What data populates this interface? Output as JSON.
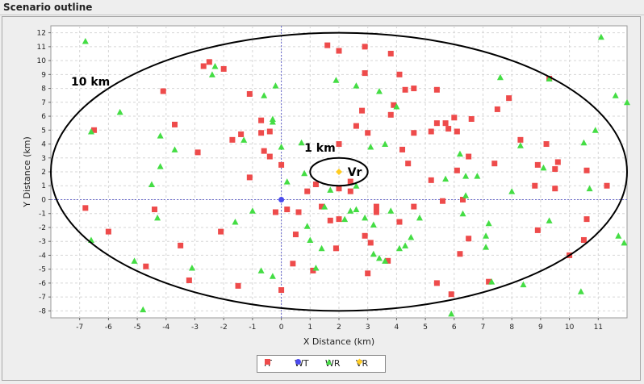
{
  "window": {
    "title": "Scenario outline"
  },
  "chart_data": {
    "type": "scatter",
    "xlabel": "X Distance (km)",
    "ylabel": "Y Distance (km)",
    "xlim": [
      -8,
      12
    ],
    "ylim": [
      -8.5,
      12.5
    ],
    "xticks": [
      -7,
      -6,
      -5,
      -4,
      -3,
      -2,
      -1,
      0,
      1,
      2,
      3,
      4,
      5,
      6,
      7,
      8,
      9,
      10,
      11
    ],
    "yticks": [
      -8,
      -7,
      -6,
      -5,
      -4,
      -3,
      -2,
      -1,
      0,
      1,
      2,
      3,
      4,
      5,
      6,
      7,
      8,
      9,
      10,
      11,
      12
    ],
    "grid": true,
    "legend_position": "bottom-center",
    "circles": [
      {
        "label": "10 km",
        "cx": 2,
        "cy": 2,
        "r": 10
      },
      {
        "label": "1 km",
        "cx": 2,
        "cy": 2,
        "r": 1
      }
    ],
    "annotations": [
      {
        "text": "Vr",
        "x": 2.3,
        "y": 2
      }
    ],
    "colors": {
      "IT": "#ee4b4b",
      "WT": "#4b4bee",
      "WR": "#44dd44",
      "VR": "#ffcc22"
    },
    "series": [
      {
        "name": "IT",
        "marker": "square",
        "points": [
          [
            -6.5,
            5
          ],
          [
            -6.8,
            -0.6
          ],
          [
            -6,
            -2.3
          ],
          [
            -4.4,
            -0.7
          ],
          [
            -4.7,
            -4.8
          ],
          [
            -4.1,
            7.8
          ],
          [
            -3.7,
            5.4
          ],
          [
            -3.5,
            -3.3
          ],
          [
            -3.2,
            -5.8
          ],
          [
            -2.9,
            3.4
          ],
          [
            -2.7,
            9.6
          ],
          [
            -2.5,
            9.9
          ],
          [
            -2.1,
            -2.3
          ],
          [
            -2,
            9.4
          ],
          [
            -1.7,
            4.3
          ],
          [
            -1.4,
            4.7
          ],
          [
            -1.5,
            -6.2
          ],
          [
            -1.1,
            7.6
          ],
          [
            -1.1,
            1.6
          ],
          [
            -0.7,
            5.7
          ],
          [
            -0.7,
            4.8
          ],
          [
            -0.6,
            3.5
          ],
          [
            -0.4,
            4.9
          ],
          [
            -0.4,
            3.1
          ],
          [
            -0.2,
            -0.9
          ],
          [
            0,
            -6.5
          ],
          [
            0,
            2.5
          ],
          [
            0.2,
            -0.7
          ],
          [
            0.4,
            -4.6
          ],
          [
            0.5,
            -2.5
          ],
          [
            0.6,
            -0.9
          ],
          [
            0.9,
            0.6
          ],
          [
            1.1,
            -5.1
          ],
          [
            1.2,
            1.1
          ],
          [
            1.4,
            -0.5
          ],
          [
            1.6,
            11.1
          ],
          [
            1.7,
            -1.5
          ],
          [
            1.9,
            -3.5
          ],
          [
            2,
            -1.4
          ],
          [
            2,
            4
          ],
          [
            2,
            0.8
          ],
          [
            2,
            10.7
          ],
          [
            2.4,
            1.3
          ],
          [
            2.4,
            0.6
          ],
          [
            2.6,
            5.3
          ],
          [
            2.8,
            6.4
          ],
          [
            2.9,
            11
          ],
          [
            2.9,
            -2.6
          ],
          [
            2.9,
            9.1
          ],
          [
            3,
            -5.3
          ],
          [
            3,
            4.8
          ],
          [
            3.1,
            -3.1
          ],
          [
            3.3,
            -0.9
          ],
          [
            3.3,
            -0.5
          ],
          [
            3.7,
            -4.4
          ],
          [
            3.8,
            10.5
          ],
          [
            3.8,
            6.1
          ],
          [
            3.9,
            6.8
          ],
          [
            4.1,
            9
          ],
          [
            4.1,
            -1.6
          ],
          [
            4.2,
            3.6
          ],
          [
            4.3,
            7.9
          ],
          [
            4.4,
            2.6
          ],
          [
            4.6,
            -0.5
          ],
          [
            4.6,
            8
          ],
          [
            4.6,
            4.8
          ],
          [
            5.2,
            1.4
          ],
          [
            5.2,
            4.9
          ],
          [
            5.4,
            -6
          ],
          [
            5.4,
            5.5
          ],
          [
            5.4,
            7.9
          ],
          [
            5.6,
            -0.1
          ],
          [
            5.7,
            5.5
          ],
          [
            5.8,
            5.1
          ],
          [
            5.9,
            -6.8
          ],
          [
            6,
            5.9
          ],
          [
            6.1,
            2.1
          ],
          [
            6.1,
            4.9
          ],
          [
            6.2,
            -3.9
          ],
          [
            6.3,
            0
          ],
          [
            6.5,
            3.1
          ],
          [
            6.5,
            -2.8
          ],
          [
            6.6,
            5.8
          ],
          [
            7.2,
            -5.9
          ],
          [
            7.4,
            2.6
          ],
          [
            7.5,
            6.5
          ],
          [
            7.9,
            7.3
          ],
          [
            8.3,
            4.3
          ],
          [
            8.8,
            1
          ],
          [
            8.9,
            2.5
          ],
          [
            8.9,
            -2.2
          ],
          [
            9.2,
            4
          ],
          [
            9.5,
            0.8
          ],
          [
            9.5,
            2.2
          ],
          [
            9.3,
            8.7
          ],
          [
            9.6,
            2.7
          ],
          [
            10,
            -4
          ],
          [
            10.5,
            -2.9
          ],
          [
            10.6,
            2.1
          ],
          [
            10.6,
            -1.4
          ],
          [
            11.3,
            1
          ]
        ]
      },
      {
        "name": "WT",
        "marker": "circle",
        "points": [
          [
            0,
            0
          ]
        ]
      },
      {
        "name": "WR",
        "marker": "triangle",
        "points": [
          [
            -6.8,
            11.4
          ],
          [
            -6.6,
            4.9
          ],
          [
            -6.6,
            -2.9
          ],
          [
            -5.6,
            6.3
          ],
          [
            -5.1,
            -4.4
          ],
          [
            -4.8,
            -7.9
          ],
          [
            -4.5,
            1.1
          ],
          [
            -4.3,
            -1.3
          ],
          [
            -4.2,
            4.6
          ],
          [
            -4.2,
            2.4
          ],
          [
            -3.7,
            3.6
          ],
          [
            -3.1,
            -4.9
          ],
          [
            -2.4,
            9
          ],
          [
            -2.3,
            9.6
          ],
          [
            -1.6,
            -1.6
          ],
          [
            -1.3,
            4.3
          ],
          [
            -1,
            -0.8
          ],
          [
            -0.7,
            -5.1
          ],
          [
            -0.6,
            7.5
          ],
          [
            -0.3,
            5.8
          ],
          [
            -0.3,
            5.6
          ],
          [
            -0.3,
            -5.5
          ],
          [
            -0.2,
            8.2
          ],
          [
            0,
            3.8
          ],
          [
            0.2,
            1.3
          ],
          [
            0.7,
            4.1
          ],
          [
            0.8,
            1.9
          ],
          [
            0.9,
            -1.9
          ],
          [
            1,
            -2.9
          ],
          [
            1.2,
            -4.9
          ],
          [
            1.4,
            -3.5
          ],
          [
            1.5,
            -0.5
          ],
          [
            1.7,
            0.7
          ],
          [
            1.9,
            8.6
          ],
          [
            2.2,
            -1.4
          ],
          [
            2.4,
            -0.8
          ],
          [
            2.6,
            1
          ],
          [
            2.6,
            -0.7
          ],
          [
            2.6,
            8.2
          ],
          [
            2.9,
            -1.3
          ],
          [
            3.1,
            3.8
          ],
          [
            3.2,
            -1.8
          ],
          [
            3.2,
            -3.9
          ],
          [
            3.4,
            7.8
          ],
          [
            3.4,
            -4.2
          ],
          [
            3.6,
            4
          ],
          [
            3.6,
            -4.4
          ],
          [
            3.8,
            -0.8
          ],
          [
            4,
            6.7
          ],
          [
            4.1,
            -3.5
          ],
          [
            4.3,
            -3.3
          ],
          [
            4.5,
            -2.7
          ],
          [
            4.8,
            -1.3
          ],
          [
            5.7,
            1.5
          ],
          [
            5.9,
            -8.2
          ],
          [
            6.2,
            3.3
          ],
          [
            6.3,
            -1
          ],
          [
            6.4,
            0.3
          ],
          [
            6.4,
            1.7
          ],
          [
            6.8,
            1.7
          ],
          [
            7.1,
            -2.6
          ],
          [
            7.1,
            -3.4
          ],
          [
            7.2,
            -1.7
          ],
          [
            7.3,
            -5.9
          ],
          [
            7.6,
            8.8
          ],
          [
            8,
            0.6
          ],
          [
            8.3,
            3.9
          ],
          [
            8.4,
            -6.1
          ],
          [
            9.1,
            2.3
          ],
          [
            9.3,
            8.7
          ],
          [
            9.3,
            -1.5
          ],
          [
            10.4,
            -6.6
          ],
          [
            10.5,
            4.1
          ],
          [
            10.7,
            0.8
          ],
          [
            10.9,
            5
          ],
          [
            11.1,
            11.7
          ],
          [
            11.6,
            7.5
          ],
          [
            11.7,
            -2.6
          ],
          [
            11.9,
            -3.1
          ],
          [
            12,
            7
          ]
        ]
      },
      {
        "name": "VR",
        "marker": "diamond",
        "points": [
          [
            2,
            2
          ]
        ]
      }
    ]
  }
}
